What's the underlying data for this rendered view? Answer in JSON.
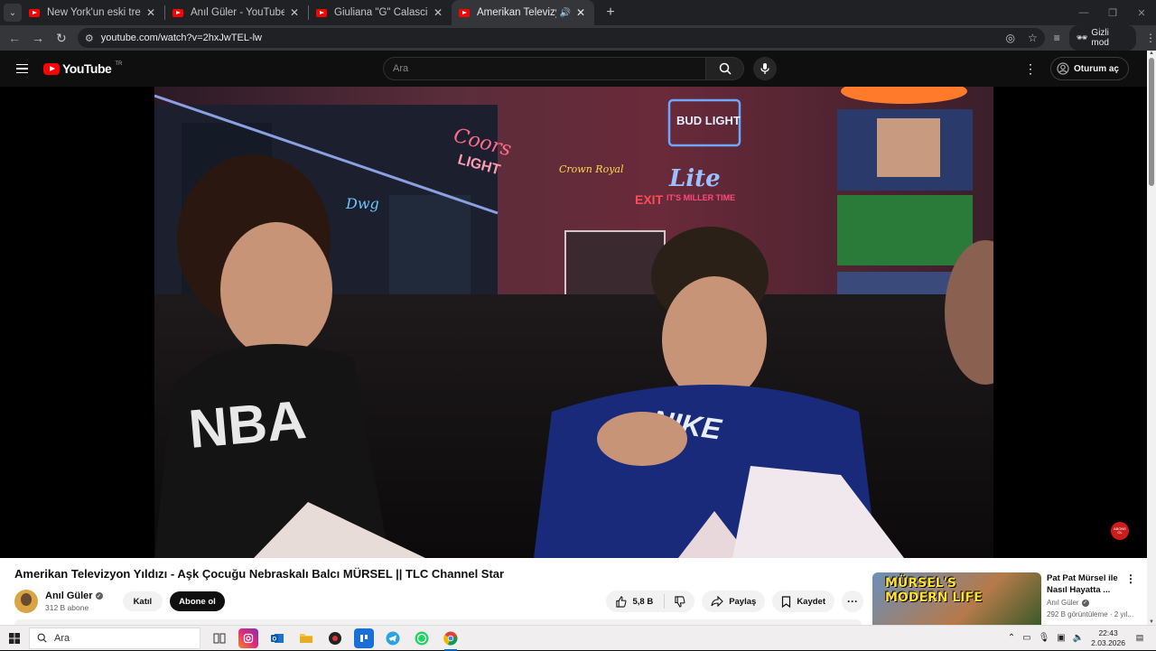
{
  "browser": {
    "tabs": [
      {
        "title": "New York'un eski tren yolunda",
        "active": false
      },
      {
        "title": "Anıl Güler - YouTube",
        "active": false
      },
      {
        "title": "Giuliana \"G\" Calascibetta - You",
        "active": false
      },
      {
        "title": "Amerikan Televizyon Yıldızı",
        "active": true
      }
    ],
    "url": "youtube.com/watch?v=2hxJwTEL-lw",
    "incognito_label": "Gizli mod"
  },
  "youtube": {
    "logo_text": "YouTube",
    "country_code": "TR",
    "search_placeholder": "Ara",
    "signin_label": "Oturum aç"
  },
  "video": {
    "title": "Amerikan Televizyon Yıldızı - Aşk Çocuğu Nebraskalı Balcı MÜRSEL || TLC Channel Star",
    "watermark": "ABONE OL",
    "channel": {
      "name": "Anıl Güler",
      "subscribers": "312 B abone"
    },
    "join_label": "Katıl",
    "subscribe_label": "Abone ol",
    "likes": "5,8 B",
    "share_label": "Paylaş",
    "save_label": "Kaydet"
  },
  "suggested": {
    "thumb_text_1": "MÜRSEL'S",
    "thumb_text_2": "MODERN LIFE",
    "title": "Pat Pat Mürsel ile Nasıl Hayatta ...",
    "channel": "Anıl Güler",
    "meta": "292 B görüntüleme · 2 yıl..."
  },
  "taskbar": {
    "search_placeholder": "Ara",
    "time": "22:43",
    "date": "2.03.2026"
  }
}
